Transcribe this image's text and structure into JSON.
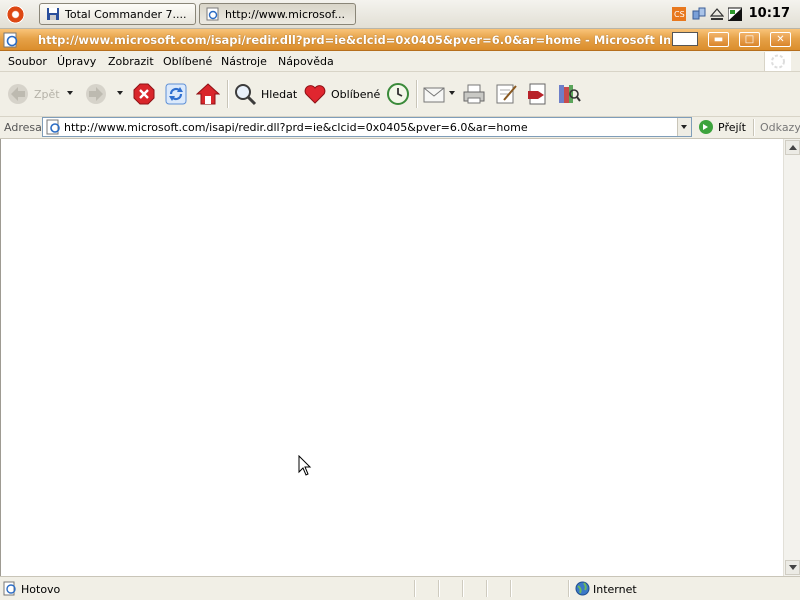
{
  "taskbar": {
    "tasks": [
      {
        "label": "Total Commander 7...."
      },
      {
        "label": "http://www.microsof..."
      }
    ],
    "clock": "10:17"
  },
  "window": {
    "title": "http://www.microsoft.com/isapi/redir.dll?prd=ie&clcid=0x0405&pver=6.0&ar=home - Microsoft Internet Explorer"
  },
  "menubar": {
    "items": [
      {
        "label": "Soubor"
      },
      {
        "label": "Úpravy"
      },
      {
        "label": "Zobrazit"
      },
      {
        "label": "Oblíbené"
      },
      {
        "label": "Nástroje"
      },
      {
        "label": "Nápověda"
      }
    ]
  },
  "toolbar": {
    "back_label": "Zpět",
    "search_label": "Hledat",
    "favorites_label": "Oblíbené"
  },
  "addressbar": {
    "label": "Adresa",
    "url": "http://www.microsoft.com/isapi/redir.dll?prd=ie&clcid=0x0405&pver=6.0&ar=home",
    "go_label": "Přejít",
    "links_label": "Odkazy"
  },
  "statusbar": {
    "status": "Hotovo",
    "zone": "Internet"
  },
  "colors": {
    "titlebar": "#e6a248",
    "chrome": "#f1efe6",
    "accent": "#dd4814"
  }
}
